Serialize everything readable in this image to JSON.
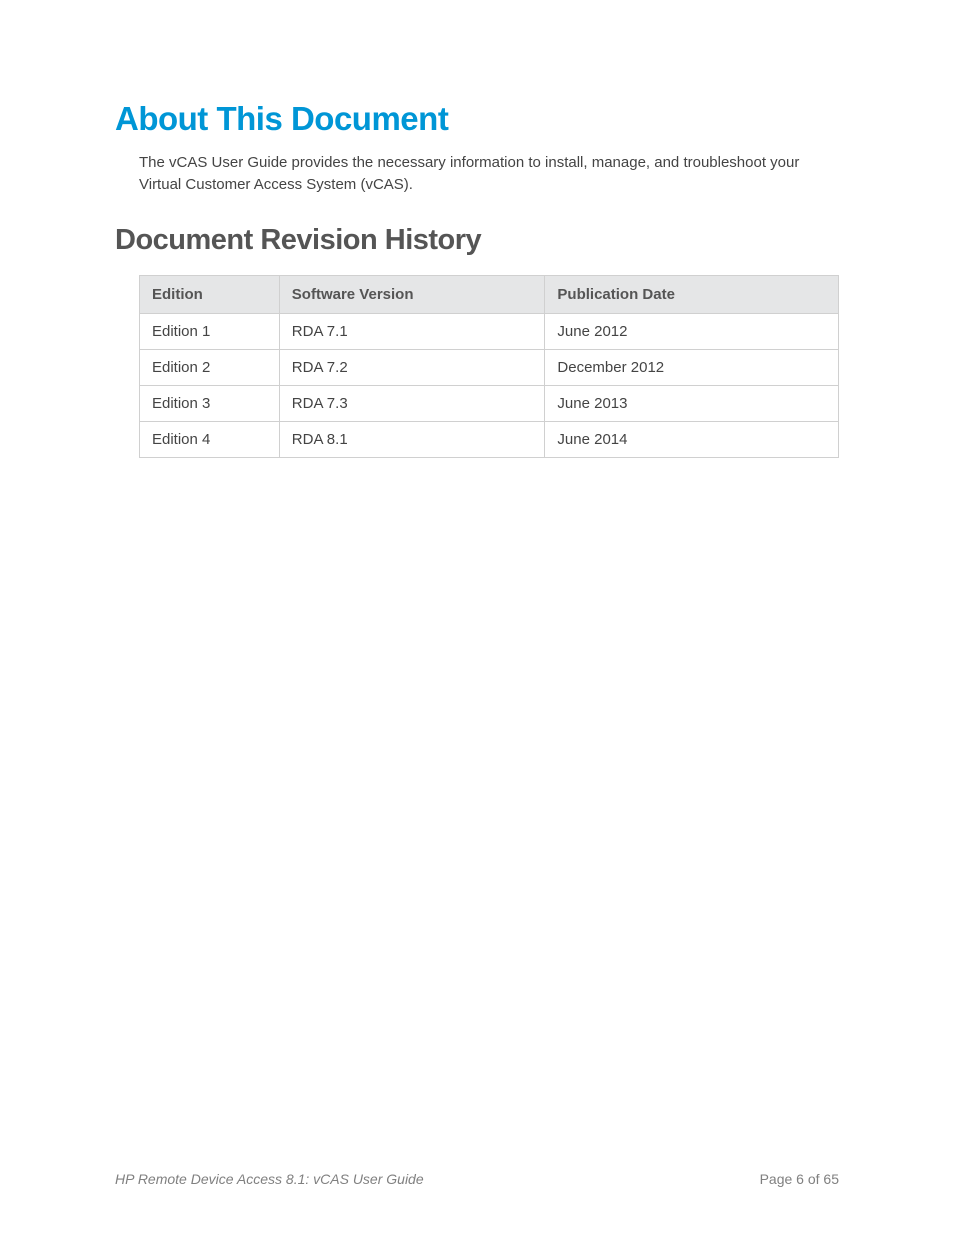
{
  "heading1": "About This Document",
  "intro": "The vCAS User Guide provides the necessary information to install, manage, and troubleshoot your Virtual Customer Access System (vCAS).",
  "heading2": "Document Revision History",
  "table": {
    "headers": {
      "edition": "Edition",
      "version": "Software Version",
      "date": "Publication Date"
    },
    "rows": [
      {
        "edition": "Edition 1",
        "version": "RDA 7.1",
        "date": "June 2012"
      },
      {
        "edition": "Edition 2",
        "version": "RDA 7.2",
        "date": "December 2012"
      },
      {
        "edition": "Edition 3",
        "version": "RDA 7.3",
        "date": "June 2013"
      },
      {
        "edition": "Edition 4",
        "version": "RDA 8.1",
        "date": "June 2014"
      }
    ]
  },
  "footer": {
    "title": "HP Remote Device Access 8.1: vCAS User Guide",
    "page": "Page 6 of 65"
  }
}
